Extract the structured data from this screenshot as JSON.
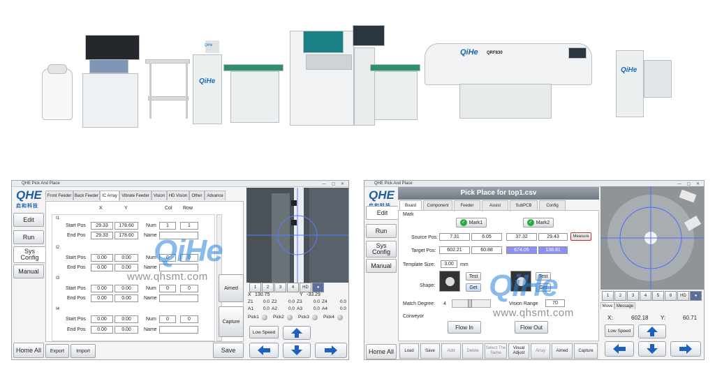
{
  "line": {
    "brand_label_a": "QiHe",
    "brand_label_b": "QiHe",
    "brand_label_c": "QiHe",
    "oven_brand": "QiHe",
    "oven_model": "QRF830"
  },
  "watermark": {
    "brand": "QiHe",
    "url": "www.qhsmt.com"
  },
  "left": {
    "title": "QHE Pick And Place",
    "logo": "QHE",
    "logo_cn": "启和科技",
    "nav": [
      "Edit",
      "Run",
      "Sys Config",
      "Manual",
      "Home All"
    ],
    "tabs": [
      "Front Feeder",
      "Back Feeder",
      "IC Array",
      "Vibrate Feeder",
      "Vision",
      "HD Vision",
      "Other",
      "Advance"
    ],
    "selected_tab": "IC Array",
    "headers": {
      "x": "X",
      "y": "Y",
      "col": "Col",
      "row": "Row"
    },
    "groups": [
      {
        "id": "I1",
        "start_label": "Start Pos",
        "end_label": "End Pos",
        "start_x": "29.33",
        "start_y": "178.60",
        "end_x": "29.33",
        "end_y": "178.60",
        "num_label": "Num",
        "name_label": "Name",
        "num_a": "1",
        "num_b": "1"
      },
      {
        "id": "I2",
        "start_label": "Start Pos",
        "end_label": "End Pos",
        "start_x": "0.00",
        "start_y": "0.00",
        "end_x": "0.00",
        "end_y": "0.00",
        "num_label": "Num",
        "name_label": "Name",
        "num_a": "0",
        "num_b": "0"
      },
      {
        "id": "I3",
        "start_label": "Start Pos",
        "end_label": "End Pos",
        "start_x": "0.00",
        "start_y": "0.00",
        "end_x": "0.00",
        "end_y": "0.00",
        "num_label": "Num",
        "name_label": "Name",
        "num_a": "0",
        "num_b": "0"
      },
      {
        "id": "I4",
        "start_label": "Start Pos",
        "end_label": "End Pos",
        "start_x": "0.00",
        "start_y": "0.00",
        "end_x": "0.00",
        "end_y": "0.00",
        "num_label": "Num",
        "name_label": "Name",
        "num_a": "0",
        "num_b": "0"
      }
    ],
    "bottom": {
      "export": "Export",
      "import": "Import",
      "save": "Save"
    },
    "side": {
      "aimed": "Aimed",
      "capture": "Capture",
      "low_speed": "Low Speed"
    },
    "cam_buttons": [
      "1",
      "2",
      "3",
      "4",
      "HD"
    ],
    "readout": {
      "x_label": "X",
      "x_val": "130.75",
      "y_label": "Y",
      "y_val": "-33.29"
    },
    "axes": [
      [
        "Z1",
        "0.0",
        "Z2",
        "0.0",
        "Z3",
        "0.0",
        "Z4",
        "0.0"
      ],
      [
        "A1",
        "0.0",
        "A2",
        "0.0",
        "A3",
        "0.0",
        "A4",
        "0.0"
      ]
    ],
    "picks": [
      "Pick1",
      "Pick2",
      "Pick3",
      "Pick4"
    ]
  },
  "right": {
    "title": "QHE Pick And Place",
    "logo": "QHE",
    "logo_cn": "启和科技",
    "header": "Pick Place for top1.csv",
    "nav": [
      "Edit",
      "Run",
      "Sys Config",
      "Manual",
      "Home All"
    ],
    "tabs": [
      "Board",
      "Component",
      "Feeder",
      "Assist",
      "SubPCB",
      "Config"
    ],
    "selected_tab": "Board",
    "mark_label": "Mark",
    "mark1": "Mark1",
    "mark2": "Mark2",
    "source_label": "Source Pos:",
    "target_label": "Target Pos:",
    "source1": [
      "7.31",
      "6.05"
    ],
    "source2": [
      "37.32",
      "29.43"
    ],
    "target1": [
      "602.21",
      "60.88"
    ],
    "target2": [
      "674.05",
      "138.91"
    ],
    "measure": "Measure",
    "template_label": "Template Size:",
    "template_val": "3.00",
    "template_unit": "mm",
    "shape_label": "Shape:",
    "test": "Test",
    "get": "Get",
    "match_label": "Match Degree:",
    "match_val": "4",
    "vision_label": "Vision Range",
    "vision_val": "70",
    "conveyor_label": "Conveyor",
    "flow_in": "Flow In",
    "flow_out": "Flow Out",
    "toolbar": [
      "Load",
      "Save",
      "Add",
      "Delete",
      "Select The Same",
      "Visual Adjust",
      "Array",
      "Aimed",
      "Capture"
    ],
    "cam_buttons": [
      "1",
      "2",
      "3",
      "4",
      "5",
      "6",
      "HD"
    ],
    "move_tabs": [
      "Move",
      "Message"
    ],
    "readout": {
      "x_label": "X:",
      "x_val": "602.18",
      "y_label": "Y:",
      "y_val": "60.71"
    },
    "low_speed": "Low Speed"
  }
}
